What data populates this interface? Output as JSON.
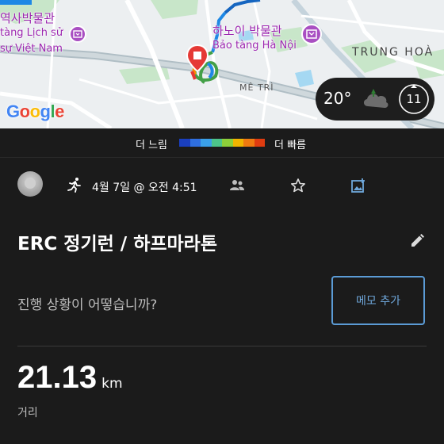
{
  "map": {
    "poi_1": "역사박물관",
    "poi_1_sub1": "tàng Lịch sử",
    "poi_1_sub2": "sự Việt Nam",
    "poi_2": "하노이 박물관",
    "poi_2_sub": "Bảo tàng Hà Nội",
    "district": "TRUNG HOÀ",
    "street": "MÊ TRÌ",
    "logo": "Google",
    "weather_temp": "20°",
    "weather_gauge": "11"
  },
  "legend": {
    "slow": "더 느림",
    "fast": "더 빠름",
    "colors": [
      "#1a3fbf",
      "#2f6fe0",
      "#3aa0e8",
      "#4cc48a",
      "#8ccf3a",
      "#f0b400",
      "#f07a10",
      "#e03c10"
    ]
  },
  "activity": {
    "date": "4월 7일 @ 오전 4:51",
    "title": "ERC 정기런 / 하프마라톤",
    "prompt": "진행 상황이 어떻습니까?",
    "memo_button": "메모 추가"
  },
  "stats": {
    "distance_value": "21.13",
    "distance_unit": "km",
    "distance_label": "거리"
  }
}
